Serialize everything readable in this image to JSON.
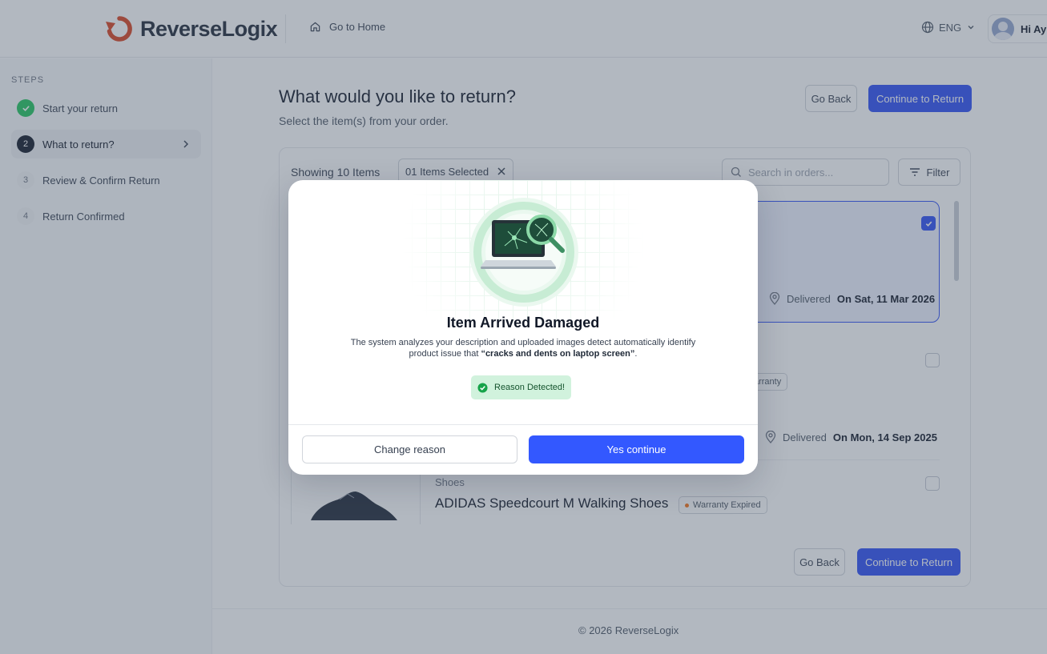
{
  "colors": {
    "accent": "#3358ff",
    "success": "#22c55e",
    "brand": "#d9431f"
  },
  "header": {
    "brand": "ReverseLogix",
    "home_link": "Go to Home",
    "language": "ENG",
    "user_greeting": "Hi Ayu"
  },
  "sidebar": {
    "title": "STEPS",
    "steps": [
      {
        "number": "1",
        "label": "Start your return",
        "state": "done"
      },
      {
        "number": "2",
        "label": "What to return?",
        "state": "current"
      },
      {
        "number": "3",
        "label": "Review & Confirm Return",
        "state": "pending"
      },
      {
        "number": "4",
        "label": "Return Confirmed",
        "state": "pending"
      }
    ]
  },
  "main": {
    "title": "What would you like to return?",
    "subtitle": "Select the item(s) from your order.",
    "go_back": "Go Back",
    "continue": "Continue to Return",
    "showing": "Showing 10 Items",
    "selected_chip": "01 Items Selected",
    "search_placeholder": "Search in orders...",
    "filter": "Filter",
    "items": [
      {
        "selected": true,
        "delivered_label": "Delivered",
        "delivered_date": "On Sat, 11 Mar 2026"
      },
      {
        "selected": false,
        "warranty": "Warranty",
        "delivered_label": "Delivered",
        "delivered_date": "On Mon, 14 Sep 2025"
      },
      {
        "selected": false,
        "category": "Shoes",
        "name": "ADIDAS Speedcourt M Walking Shoes",
        "warranty": "Warranty Expired"
      }
    ]
  },
  "footer": {
    "copyright": "© 2026 ReverseLogix"
  },
  "modal": {
    "title": "Item Arrived Damaged",
    "description_prefix": "The system analyzes your description and uploaded images detect automatically identify product issue that ",
    "description_highlight": "“cracks and dents on laptop screen”",
    "description_suffix": ".",
    "badge": "Reason Detected!",
    "secondary_button": "Change reason",
    "primary_button": "Yes continue"
  }
}
